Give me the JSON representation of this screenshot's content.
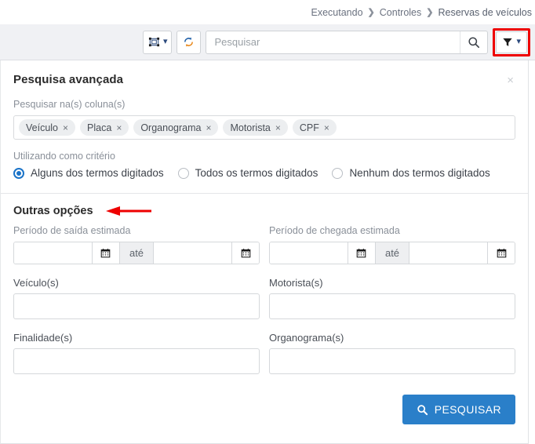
{
  "breadcrumb": {
    "items": [
      "Executando",
      "Controles",
      "Reservas de veículos"
    ],
    "separator": "❯"
  },
  "toolbar": {
    "view_button_icon": "select-frame-icon",
    "refresh_button_icon": "refresh-icon",
    "search": {
      "placeholder": "Pesquisar",
      "value": ""
    },
    "search_icon": "search-icon",
    "filter_button_icon": "filter-icon",
    "filter_highlight_color": "#ee0000"
  },
  "panel": {
    "title": "Pesquisa avançada",
    "close_label": "×",
    "columns_label": "Pesquisar na(s) coluna(s)",
    "tags": [
      {
        "label": "Veículo",
        "remove": "×"
      },
      {
        "label": "Placa",
        "remove": "×"
      },
      {
        "label": "Organograma",
        "remove": "×"
      },
      {
        "label": "Motorista",
        "remove": "×"
      },
      {
        "label": "CPF",
        "remove": "×"
      }
    ],
    "criteria_label": "Utilizando como critério",
    "criteria_options": [
      {
        "label": "Alguns dos termos digitados",
        "selected": true
      },
      {
        "label": "Todos os termos digitados",
        "selected": false
      },
      {
        "label": "Nenhum dos termos digitados",
        "selected": false
      }
    ],
    "accent_color": "#1a73c8",
    "other_options": {
      "title": "Outras opções",
      "annotation_arrow_color": "#ee0000",
      "departure_period_label": "Período de saída estimada",
      "arrival_period_label": "Período de chegada estimada",
      "range_separator": "até",
      "calendar_icon": "calendar-icon",
      "departure_from": "",
      "departure_to": "",
      "arrival_from": "",
      "arrival_to": "",
      "vehicles_label": "Veículo(s)",
      "vehicles_value": "",
      "drivers_label": "Motorista(s)",
      "drivers_value": "",
      "purposes_label": "Finalidade(s)",
      "purposes_value": "",
      "orgchart_label": "Organograma(s)",
      "orgchart_value": ""
    },
    "submit": {
      "label": "PESQUISAR",
      "icon": "search-icon",
      "color": "#2a7fc9"
    }
  }
}
